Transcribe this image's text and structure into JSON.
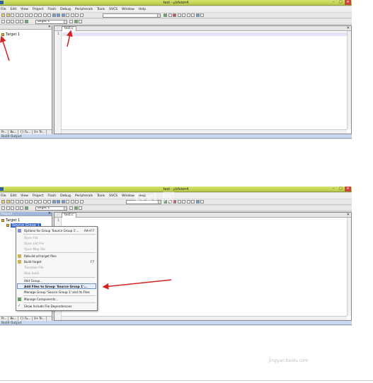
{
  "top": {
    "window_title": "test - µVision4",
    "menu": [
      "File",
      "Edit",
      "View",
      "Project",
      "Flash",
      "Debug",
      "Peripherals",
      "Tools",
      "SVCS",
      "Window",
      "Help"
    ],
    "target_combo": "Target 1",
    "tree_root": "Target 1",
    "editor_tab": "test.c",
    "line_number": "1",
    "project_tabs": [
      "Pr...",
      "Bo...",
      "{} Fu...",
      "0+ Te..."
    ],
    "build_output_label": "Build Output",
    "win_buttons": [
      "–",
      "□",
      "✕"
    ]
  },
  "bottom": {
    "window_title": "test - µVision4",
    "menu": [
      "File",
      "Edit",
      "View",
      "Project",
      "Flash",
      "Debug",
      "Peripherals",
      "Tools",
      "SVCS",
      "Window",
      "Help"
    ],
    "target_combo": "Target 1",
    "tree_root": "Target 1",
    "tree_group": "Source Group 1",
    "project_header": "Project",
    "editor_tab": "test.c",
    "line_number": "1",
    "project_tabs": [
      "Pr...",
      "Bo...",
      "{} Fu...",
      "0+ Te..."
    ],
    "build_output_label": "Build Output",
    "win_buttons": [
      "–",
      "□",
      "✕"
    ],
    "context_menu": [
      {
        "label": "Options for Group 'Source Group 1'...",
        "shortcut": "Alt+F7",
        "enabled": true
      },
      {
        "label": "Open File",
        "shortcut": "",
        "enabled": false
      },
      {
        "label": "Open List File",
        "shortcut": "",
        "enabled": false
      },
      {
        "label": "Open Map File",
        "shortcut": "",
        "enabled": false
      },
      {
        "label": "Rebuild all target files",
        "shortcut": "",
        "enabled": true
      },
      {
        "label": "Build target",
        "shortcut": "F7",
        "enabled": true
      },
      {
        "label": "Translate File",
        "shortcut": "",
        "enabled": false
      },
      {
        "label": "Stop build",
        "shortcut": "",
        "enabled": false
      },
      {
        "label": "Add Group...",
        "shortcut": "",
        "enabled": true
      },
      {
        "label": "Add Files to Group 'Source Group 1'...",
        "shortcut": "",
        "enabled": true
      },
      {
        "label": "Manage Group 'Source Group 1' and its Files",
        "shortcut": "",
        "enabled": true
      },
      {
        "label": "Manage Components...",
        "shortcut": "",
        "enabled": true
      },
      {
        "label": "Show Include File Dependencies",
        "shortcut": "",
        "enabled": true
      }
    ],
    "watermark": "Gxi 网",
    "corner_watermark": "jingyan.baidu.com"
  },
  "colors": {
    "annotation_red": "#d42020",
    "titlebar": "#c8d85a",
    "selection_blue": "#3366cc"
  }
}
